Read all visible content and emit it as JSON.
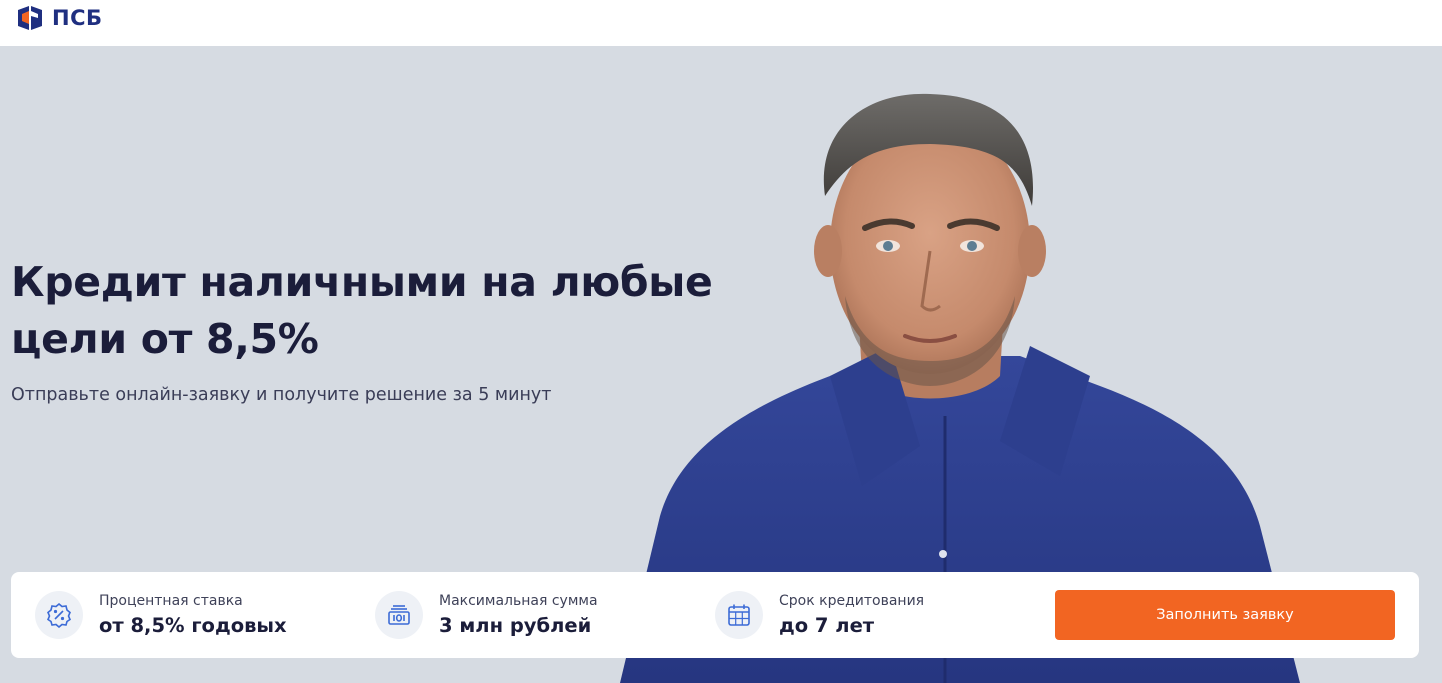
{
  "header": {
    "logo_text": "ПСБ",
    "logo_icon": "psb-logo-icon"
  },
  "hero": {
    "title_line1": "Кредит наличными на любые",
    "title_line2": "цели от 8,5%",
    "subtitle": "Отправьте онлайн-заявку и получите решение за 5 минут"
  },
  "features": [
    {
      "icon": "percent-badge-icon",
      "label": "Процентная ставка",
      "value": "от 8,5% годовых"
    },
    {
      "icon": "money-stack-icon",
      "label": "Максимальная сумма",
      "value": "3 млн рублей"
    },
    {
      "icon": "calendar-icon",
      "label": "Срок кредитования",
      "value": "до 7 лет"
    }
  ],
  "cta": {
    "label": "Заполнить заявку"
  },
  "colors": {
    "brand_blue": "#1f2f80",
    "accent_orange": "#f26522",
    "hero_bg": "#d6dbe2",
    "shirt_blue": "#2e3f8f"
  }
}
